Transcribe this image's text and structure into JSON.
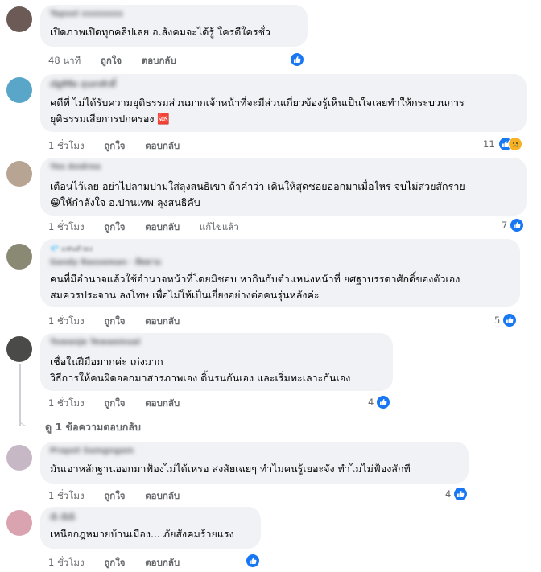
{
  "comments": [
    {
      "author": "Tapsol xxxxxxxx",
      "lines": [
        "เปิดภาพเปิดทุกคลิปเลย อ.สังคมจะได้รู้ ใครดีใครชั่ว"
      ],
      "time": "48 นาที",
      "like_label": "ถูกใจ",
      "reply_label": "ตอบกลับ",
      "reaction_count": "",
      "reactions": [
        "like"
      ]
    },
    {
      "author": "ณัฐพิชิต สุนทรศักดิ์",
      "lines": [
        "คดีที่ ไม่ได้รับความยุติธรรมส่วนมากเจ้าหน้าที่จะมีส่วนเกี่ยวข้องรู้เห็นเป็นใจเลยทำให้กระบวนการ",
        "ยุติธรรมเสียการปกครอง 🆘"
      ],
      "time": "1 ชั่วโมง",
      "like_label": "ถูกใจ",
      "reply_label": "ตอบกลับ",
      "reaction_count": "11",
      "reactions": [
        "like",
        "haha"
      ]
    },
    {
      "author": "Yes Andrea",
      "lines": [
        "เตือนไว้เลย อย่าไปลามปามใส่ลุงสนธิเขา ถ้าคำว่า เดินให้สุดซอยออกมาเมื่อไหร่ จบไม่สวยสักราย",
        "😁ให้กำลังใจ อ.ปานเทพ ลุงสนธิคับ"
      ],
      "time": "1 ชั่วโมง",
      "like_label": "ถูกใจ",
      "reply_label": "ตอบกลับ",
      "edited_label": "แก้ไขแล้ว",
      "reaction_count": "7",
      "reactions": [
        "like"
      ]
    },
    {
      "badge": "💎 แฟนตัวยง",
      "author": "Sandy Rasseman · ติดตาม",
      "lines": [
        "คนที่มีอำนาจแล้วใช้อำนาจหน้าที่โดยมิชอบ หากินกับตำแหน่งหน้าที่ ยศฐาบรรดาศักดิ์ของตัวเอง",
        "สมควรประจาน ลงโทษ เพื่อไม่ให้เป็นเยี่ยงอย่างต่อคนรุ่นหลังค่ะ"
      ],
      "time": "1 ชั่วโมง",
      "like_label": "ถูกใจ",
      "reply_label": "ตอบกลับ",
      "reaction_count": "5",
      "reactions": [
        "like"
      ]
    },
    {
      "author": "Tuwanje Tewaemual",
      "lines": [
        "เชื่อในฝีมือมากค่ะ เก่งมาก",
        "วิธีการให้คนผิดออกมาสารภาพเอง ดิ้นรนกันเอง และเริ่มทะเลาะกันเอง"
      ],
      "time": "1 ชั่วโมง",
      "like_label": "ถูกใจ",
      "reply_label": "ตอบกลับ",
      "reaction_count": "4",
      "reactions": [
        "like"
      ],
      "view_replies": "ดู 1 ข้อความตอบกลับ"
    },
    {
      "author": "Prapot Samgngam",
      "lines": [
        "มันเอาหลักฐานออกมาฟ้องไม่ได้เหรอ สงสัยเฉยๆ ทำไมคนรู้เยอะจัง ทำไมไม่ฟ้องสักที"
      ],
      "time": "1 ชั่วโมง",
      "like_label": "ถูกใจ",
      "reply_label": "ตอบกลับ",
      "reaction_count": "4",
      "reactions": [
        "like"
      ]
    },
    {
      "author": "ณิ ณิณิ",
      "lines": [
        "เหนือกฎหมายบ้านเมือง... ภัยสังคมร้ายแรง"
      ],
      "time": "1 ชั่วโมง",
      "like_label": "ถูกใจ",
      "reply_label": "ตอบกลับ",
      "reaction_count": "",
      "reactions": [
        "like"
      ]
    }
  ],
  "colors": {
    "bubble_bg": "#f0f2f5",
    "secondary_text": "#65676b",
    "like_blue": "#1877f2",
    "haha_yellow": "#f7b125"
  }
}
